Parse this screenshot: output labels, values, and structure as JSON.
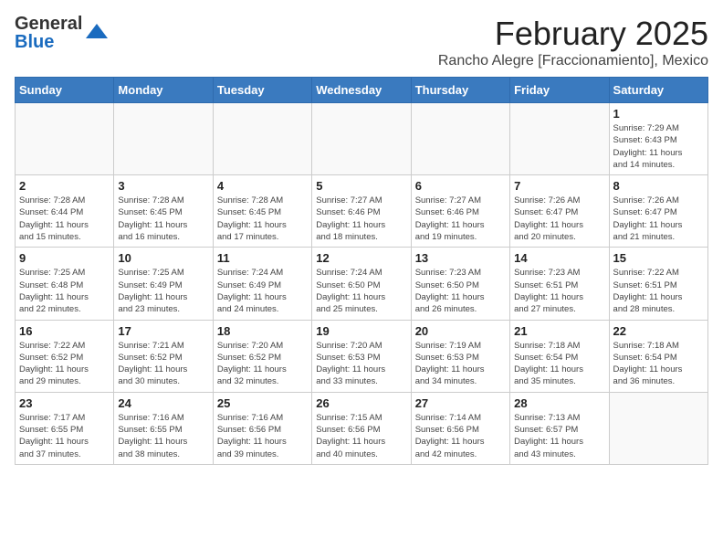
{
  "header": {
    "logo_general": "General",
    "logo_blue": "Blue",
    "main_title": "February 2025",
    "subtitle": "Rancho Alegre [Fraccionamiento], Mexico"
  },
  "weekdays": [
    "Sunday",
    "Monday",
    "Tuesday",
    "Wednesday",
    "Thursday",
    "Friday",
    "Saturday"
  ],
  "weeks": [
    [
      {
        "day": "",
        "info": ""
      },
      {
        "day": "",
        "info": ""
      },
      {
        "day": "",
        "info": ""
      },
      {
        "day": "",
        "info": ""
      },
      {
        "day": "",
        "info": ""
      },
      {
        "day": "",
        "info": ""
      },
      {
        "day": "1",
        "info": "Sunrise: 7:29 AM\nSunset: 6:43 PM\nDaylight: 11 hours\nand 14 minutes."
      }
    ],
    [
      {
        "day": "2",
        "info": "Sunrise: 7:28 AM\nSunset: 6:44 PM\nDaylight: 11 hours\nand 15 minutes."
      },
      {
        "day": "3",
        "info": "Sunrise: 7:28 AM\nSunset: 6:45 PM\nDaylight: 11 hours\nand 16 minutes."
      },
      {
        "day": "4",
        "info": "Sunrise: 7:28 AM\nSunset: 6:45 PM\nDaylight: 11 hours\nand 17 minutes."
      },
      {
        "day": "5",
        "info": "Sunrise: 7:27 AM\nSunset: 6:46 PM\nDaylight: 11 hours\nand 18 minutes."
      },
      {
        "day": "6",
        "info": "Sunrise: 7:27 AM\nSunset: 6:46 PM\nDaylight: 11 hours\nand 19 minutes."
      },
      {
        "day": "7",
        "info": "Sunrise: 7:26 AM\nSunset: 6:47 PM\nDaylight: 11 hours\nand 20 minutes."
      },
      {
        "day": "8",
        "info": "Sunrise: 7:26 AM\nSunset: 6:47 PM\nDaylight: 11 hours\nand 21 minutes."
      }
    ],
    [
      {
        "day": "9",
        "info": "Sunrise: 7:25 AM\nSunset: 6:48 PM\nDaylight: 11 hours\nand 22 minutes."
      },
      {
        "day": "10",
        "info": "Sunrise: 7:25 AM\nSunset: 6:49 PM\nDaylight: 11 hours\nand 23 minutes."
      },
      {
        "day": "11",
        "info": "Sunrise: 7:24 AM\nSunset: 6:49 PM\nDaylight: 11 hours\nand 24 minutes."
      },
      {
        "day": "12",
        "info": "Sunrise: 7:24 AM\nSunset: 6:50 PM\nDaylight: 11 hours\nand 25 minutes."
      },
      {
        "day": "13",
        "info": "Sunrise: 7:23 AM\nSunset: 6:50 PM\nDaylight: 11 hours\nand 26 minutes."
      },
      {
        "day": "14",
        "info": "Sunrise: 7:23 AM\nSunset: 6:51 PM\nDaylight: 11 hours\nand 27 minutes."
      },
      {
        "day": "15",
        "info": "Sunrise: 7:22 AM\nSunset: 6:51 PM\nDaylight: 11 hours\nand 28 minutes."
      }
    ],
    [
      {
        "day": "16",
        "info": "Sunrise: 7:22 AM\nSunset: 6:52 PM\nDaylight: 11 hours\nand 29 minutes."
      },
      {
        "day": "17",
        "info": "Sunrise: 7:21 AM\nSunset: 6:52 PM\nDaylight: 11 hours\nand 30 minutes."
      },
      {
        "day": "18",
        "info": "Sunrise: 7:20 AM\nSunset: 6:52 PM\nDaylight: 11 hours\nand 32 minutes."
      },
      {
        "day": "19",
        "info": "Sunrise: 7:20 AM\nSunset: 6:53 PM\nDaylight: 11 hours\nand 33 minutes."
      },
      {
        "day": "20",
        "info": "Sunrise: 7:19 AM\nSunset: 6:53 PM\nDaylight: 11 hours\nand 34 minutes."
      },
      {
        "day": "21",
        "info": "Sunrise: 7:18 AM\nSunset: 6:54 PM\nDaylight: 11 hours\nand 35 minutes."
      },
      {
        "day": "22",
        "info": "Sunrise: 7:18 AM\nSunset: 6:54 PM\nDaylight: 11 hours\nand 36 minutes."
      }
    ],
    [
      {
        "day": "23",
        "info": "Sunrise: 7:17 AM\nSunset: 6:55 PM\nDaylight: 11 hours\nand 37 minutes."
      },
      {
        "day": "24",
        "info": "Sunrise: 7:16 AM\nSunset: 6:55 PM\nDaylight: 11 hours\nand 38 minutes."
      },
      {
        "day": "25",
        "info": "Sunrise: 7:16 AM\nSunset: 6:56 PM\nDaylight: 11 hours\nand 39 minutes."
      },
      {
        "day": "26",
        "info": "Sunrise: 7:15 AM\nSunset: 6:56 PM\nDaylight: 11 hours\nand 40 minutes."
      },
      {
        "day": "27",
        "info": "Sunrise: 7:14 AM\nSunset: 6:56 PM\nDaylight: 11 hours\nand 42 minutes."
      },
      {
        "day": "28",
        "info": "Sunrise: 7:13 AM\nSunset: 6:57 PM\nDaylight: 11 hours\nand 43 minutes."
      },
      {
        "day": "",
        "info": ""
      }
    ]
  ]
}
